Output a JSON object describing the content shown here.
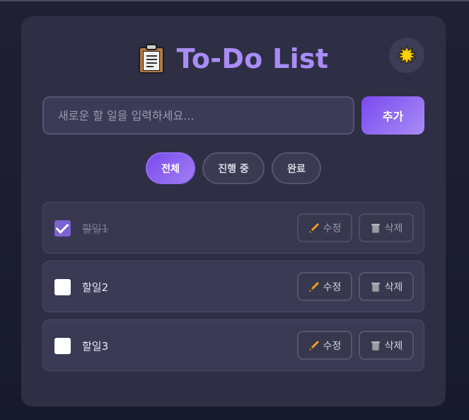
{
  "app": {
    "title": "To-Do List",
    "icon": "clipboard-icon",
    "theme_toggle_icon": "sun-icon"
  },
  "input": {
    "placeholder": "새로운 할 일을 입력하세요...",
    "value": ""
  },
  "add_button": {
    "label": "추가"
  },
  "filters": [
    {
      "label": "전체",
      "active": true
    },
    {
      "label": "진행 중",
      "active": false
    },
    {
      "label": "완료",
      "active": false
    }
  ],
  "todos": [
    {
      "text": "할일1",
      "completed": true,
      "edit_label": "수정",
      "delete_label": "삭제"
    },
    {
      "text": "할일2",
      "completed": false,
      "edit_label": "수정",
      "delete_label": "삭제"
    },
    {
      "text": "할일3",
      "completed": false,
      "edit_label": "수정",
      "delete_label": "삭제"
    }
  ],
  "colors": {
    "accent": "#8b63f0",
    "title": "#a98cf5",
    "card": "#2e2e45"
  }
}
